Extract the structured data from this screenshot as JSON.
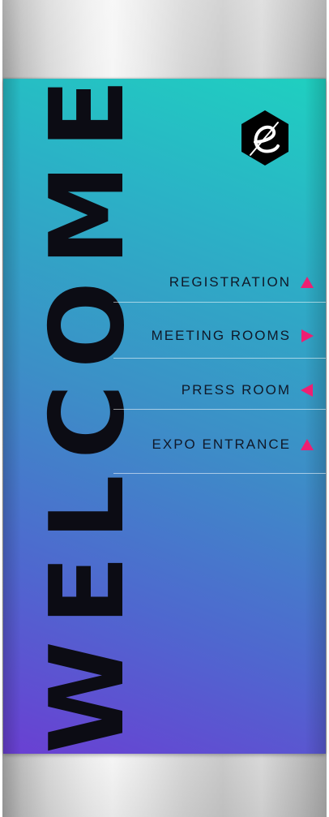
{
  "banner": {
    "welcome_text": "WELCOME",
    "welcome_letters": [
      "W",
      "E",
      "L",
      "C",
      "O",
      "M",
      "E"
    ],
    "gradient_colors": [
      "#1fd0c0",
      "#3c8fc7",
      "#6a3fd3"
    ],
    "text_color": "#0c0c14"
  },
  "logo": {
    "icon": "e-hexagon-logo-icon",
    "letter": "e",
    "background": "#000000",
    "foreground": "#ffffff"
  },
  "directions": [
    {
      "label": "REGISTRATION",
      "arrow": "up-arrow-icon"
    },
    {
      "label": "MEETING ROOMS",
      "arrow": "right-arrow-icon"
    },
    {
      "label": "PRESS ROOM",
      "arrow": "left-arrow-icon"
    },
    {
      "label": "EXPO ENTRANCE",
      "arrow": "up-arrow-icon"
    }
  ],
  "accent_color": "#ee1f72"
}
